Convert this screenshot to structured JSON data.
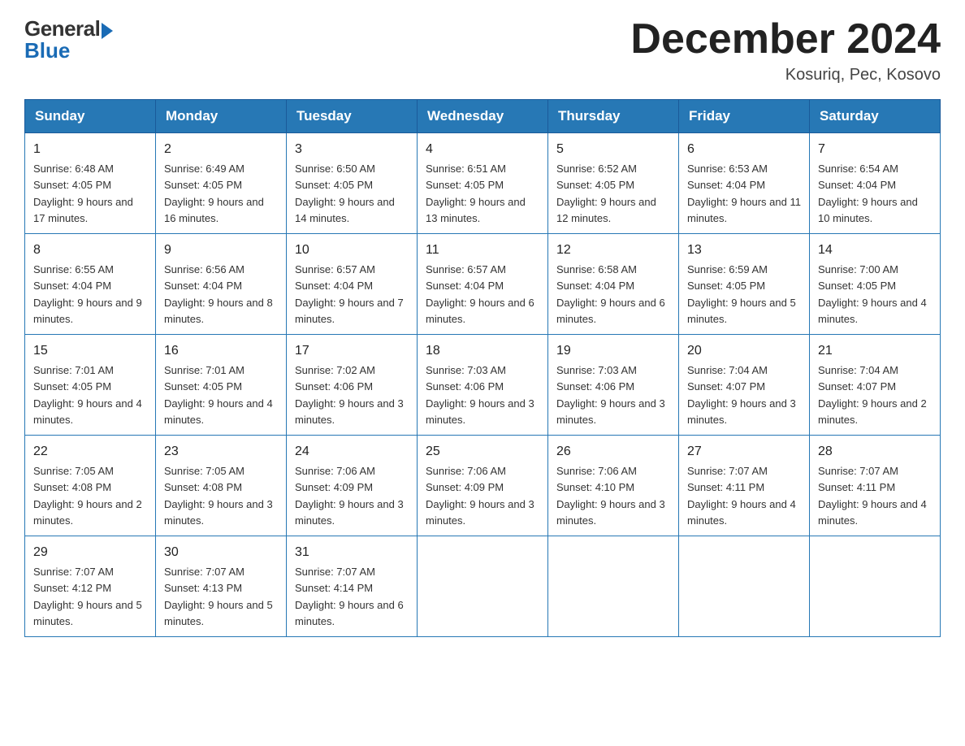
{
  "header": {
    "logo_general": "General",
    "logo_blue": "Blue",
    "title": "December 2024",
    "location": "Kosuriq, Pec, Kosovo"
  },
  "days_of_week": [
    "Sunday",
    "Monday",
    "Tuesday",
    "Wednesday",
    "Thursday",
    "Friday",
    "Saturday"
  ],
  "weeks": [
    [
      {
        "day": "1",
        "sunrise": "6:48 AM",
        "sunset": "4:05 PM",
        "daylight": "9 hours and 17 minutes."
      },
      {
        "day": "2",
        "sunrise": "6:49 AM",
        "sunset": "4:05 PM",
        "daylight": "9 hours and 16 minutes."
      },
      {
        "day": "3",
        "sunrise": "6:50 AM",
        "sunset": "4:05 PM",
        "daylight": "9 hours and 14 minutes."
      },
      {
        "day": "4",
        "sunrise": "6:51 AM",
        "sunset": "4:05 PM",
        "daylight": "9 hours and 13 minutes."
      },
      {
        "day": "5",
        "sunrise": "6:52 AM",
        "sunset": "4:05 PM",
        "daylight": "9 hours and 12 minutes."
      },
      {
        "day": "6",
        "sunrise": "6:53 AM",
        "sunset": "4:04 PM",
        "daylight": "9 hours and 11 minutes."
      },
      {
        "day": "7",
        "sunrise": "6:54 AM",
        "sunset": "4:04 PM",
        "daylight": "9 hours and 10 minutes."
      }
    ],
    [
      {
        "day": "8",
        "sunrise": "6:55 AM",
        "sunset": "4:04 PM",
        "daylight": "9 hours and 9 minutes."
      },
      {
        "day": "9",
        "sunrise": "6:56 AM",
        "sunset": "4:04 PM",
        "daylight": "9 hours and 8 minutes."
      },
      {
        "day": "10",
        "sunrise": "6:57 AM",
        "sunset": "4:04 PM",
        "daylight": "9 hours and 7 minutes."
      },
      {
        "day": "11",
        "sunrise": "6:57 AM",
        "sunset": "4:04 PM",
        "daylight": "9 hours and 6 minutes."
      },
      {
        "day": "12",
        "sunrise": "6:58 AM",
        "sunset": "4:04 PM",
        "daylight": "9 hours and 6 minutes."
      },
      {
        "day": "13",
        "sunrise": "6:59 AM",
        "sunset": "4:05 PM",
        "daylight": "9 hours and 5 minutes."
      },
      {
        "day": "14",
        "sunrise": "7:00 AM",
        "sunset": "4:05 PM",
        "daylight": "9 hours and 4 minutes."
      }
    ],
    [
      {
        "day": "15",
        "sunrise": "7:01 AM",
        "sunset": "4:05 PM",
        "daylight": "9 hours and 4 minutes."
      },
      {
        "day": "16",
        "sunrise": "7:01 AM",
        "sunset": "4:05 PM",
        "daylight": "9 hours and 4 minutes."
      },
      {
        "day": "17",
        "sunrise": "7:02 AM",
        "sunset": "4:06 PM",
        "daylight": "9 hours and 3 minutes."
      },
      {
        "day": "18",
        "sunrise": "7:03 AM",
        "sunset": "4:06 PM",
        "daylight": "9 hours and 3 minutes."
      },
      {
        "day": "19",
        "sunrise": "7:03 AM",
        "sunset": "4:06 PM",
        "daylight": "9 hours and 3 minutes."
      },
      {
        "day": "20",
        "sunrise": "7:04 AM",
        "sunset": "4:07 PM",
        "daylight": "9 hours and 3 minutes."
      },
      {
        "day": "21",
        "sunrise": "7:04 AM",
        "sunset": "4:07 PM",
        "daylight": "9 hours and 2 minutes."
      }
    ],
    [
      {
        "day": "22",
        "sunrise": "7:05 AM",
        "sunset": "4:08 PM",
        "daylight": "9 hours and 2 minutes."
      },
      {
        "day": "23",
        "sunrise": "7:05 AM",
        "sunset": "4:08 PM",
        "daylight": "9 hours and 3 minutes."
      },
      {
        "day": "24",
        "sunrise": "7:06 AM",
        "sunset": "4:09 PM",
        "daylight": "9 hours and 3 minutes."
      },
      {
        "day": "25",
        "sunrise": "7:06 AM",
        "sunset": "4:09 PM",
        "daylight": "9 hours and 3 minutes."
      },
      {
        "day": "26",
        "sunrise": "7:06 AM",
        "sunset": "4:10 PM",
        "daylight": "9 hours and 3 minutes."
      },
      {
        "day": "27",
        "sunrise": "7:07 AM",
        "sunset": "4:11 PM",
        "daylight": "9 hours and 4 minutes."
      },
      {
        "day": "28",
        "sunrise": "7:07 AM",
        "sunset": "4:11 PM",
        "daylight": "9 hours and 4 minutes."
      }
    ],
    [
      {
        "day": "29",
        "sunrise": "7:07 AM",
        "sunset": "4:12 PM",
        "daylight": "9 hours and 5 minutes."
      },
      {
        "day": "30",
        "sunrise": "7:07 AM",
        "sunset": "4:13 PM",
        "daylight": "9 hours and 5 minutes."
      },
      {
        "day": "31",
        "sunrise": "7:07 AM",
        "sunset": "4:14 PM",
        "daylight": "9 hours and 6 minutes."
      },
      null,
      null,
      null,
      null
    ]
  ]
}
